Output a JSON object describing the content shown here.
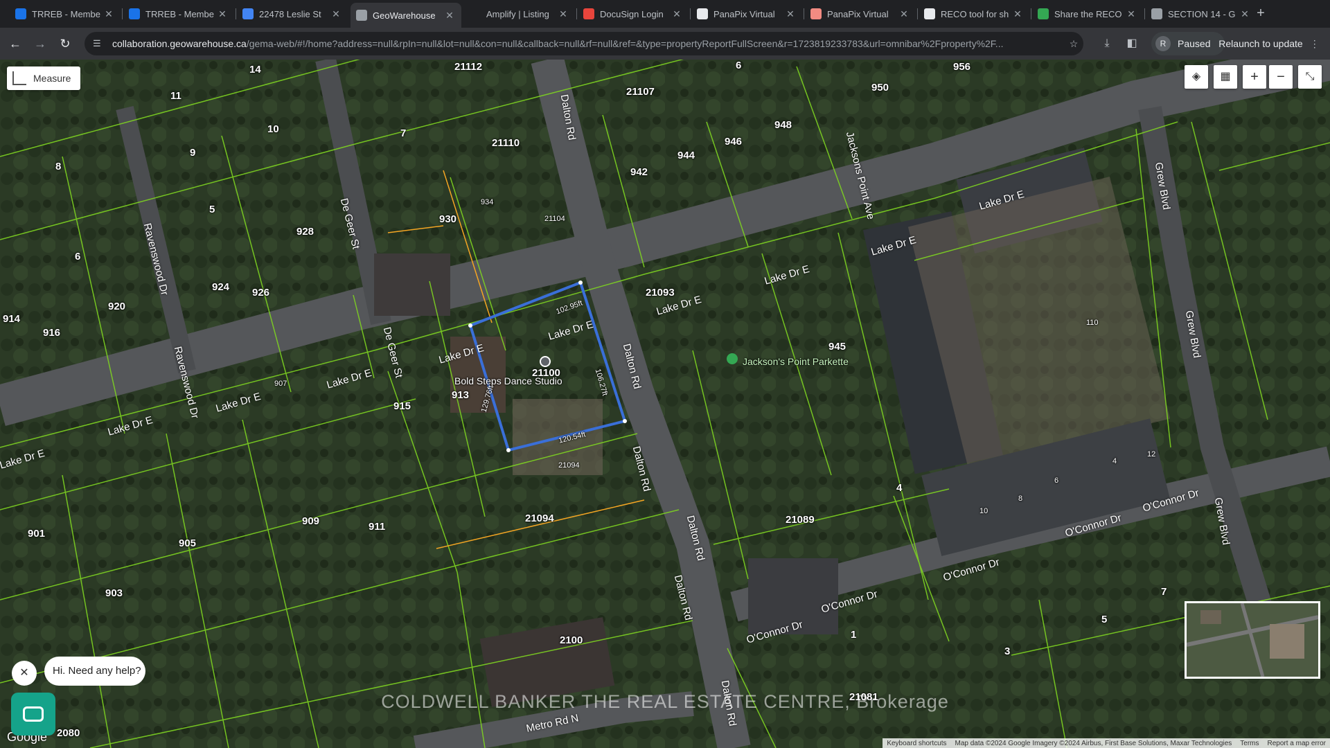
{
  "tabs": [
    {
      "title": "TRREB - Membe",
      "favicon_color": "#1a73e8",
      "active": false
    },
    {
      "title": "TRREB - Membe",
      "favicon_color": "#1a73e8",
      "active": false
    },
    {
      "title": "22478 Leslie St",
      "favicon_color": "#4285f4",
      "active": false
    },
    {
      "title": "GeoWarehouse",
      "favicon_color": "#9aa0a6",
      "active": true
    },
    {
      "title": "Amplify | Listing",
      "favicon_color": "#202124",
      "active": false
    },
    {
      "title": "DocuSign Login",
      "favicon_color": "#e8453c",
      "active": false
    },
    {
      "title": "PanaPix Virtual",
      "favicon_color": "#e8eaed",
      "active": false
    },
    {
      "title": "PanaPix Virtual",
      "favicon_color": "#f28b82",
      "active": false
    },
    {
      "title": "RECO tool for sh",
      "favicon_color": "#e8eaed",
      "active": false
    },
    {
      "title": "Share the RECO",
      "favicon_color": "#34a853",
      "active": false
    },
    {
      "title": "SECTION 14 - G",
      "favicon_color": "#9aa0a6",
      "active": false
    }
  ],
  "url": {
    "host": "collaboration.geowarehouse.ca",
    "path": "/gema-web/#!/home?address=null&rpIn=null&lot=null&con=null&callback=null&rf=null&ref=&type=propertyReportFullScreen&r=1723819233783&url=omnibar%2Fproperty%2F..."
  },
  "profile": {
    "initial": "R",
    "status": "Paused"
  },
  "relaunch_label": "Relaunch to update",
  "map": {
    "measure_label": "Measure",
    "highlight_color": "#3a6fd8",
    "parcel_line_color": "#7ed321",
    "parcels": [
      {
        "label": "21112"
      },
      {
        "label": "14"
      },
      {
        "label": "11"
      },
      {
        "label": "10"
      },
      {
        "label": "9"
      },
      {
        "label": "8"
      },
      {
        "label": "7"
      },
      {
        "label": "5"
      },
      {
        "label": "6"
      },
      {
        "label": "928"
      },
      {
        "label": "924"
      },
      {
        "label": "926"
      },
      {
        "label": "920"
      },
      {
        "label": "916"
      },
      {
        "label": "914"
      },
      {
        "label": "930"
      },
      {
        "label": "934"
      },
      {
        "label": "21104"
      },
      {
        "label": "21110"
      },
      {
        "label": "21107"
      },
      {
        "label": "944"
      },
      {
        "label": "942"
      },
      {
        "label": "946"
      },
      {
        "label": "948"
      },
      {
        "label": "950"
      },
      {
        "label": "956"
      },
      {
        "label": "6"
      },
      {
        "label": "21093"
      },
      {
        "label": "945"
      },
      {
        "label": "21100"
      },
      {
        "label": "915"
      },
      {
        "label": "913"
      },
      {
        "label": "907"
      },
      {
        "label": "909"
      },
      {
        "label": "905"
      },
      {
        "label": "903"
      },
      {
        "label": "901"
      },
      {
        "label": "911"
      },
      {
        "label": "21094"
      },
      {
        "label": "21094"
      },
      {
        "label": "21089"
      },
      {
        "label": "2100"
      },
      {
        "label": "1"
      },
      {
        "label": "3"
      },
      {
        "label": "5"
      },
      {
        "label": "7"
      },
      {
        "label": "4"
      },
      {
        "label": "21081"
      },
      {
        "label": "2080"
      },
      {
        "label": "10"
      },
      {
        "label": "8"
      },
      {
        "label": "6"
      },
      {
        "label": "12"
      },
      {
        "label": "4"
      },
      {
        "label": "110"
      }
    ],
    "roads": [
      {
        "name": "Lake Dr E"
      },
      {
        "name": "Lake Dr E"
      },
      {
        "name": "Lake Dr E"
      },
      {
        "name": "Lake Dr E"
      },
      {
        "name": "Lake Dr E"
      },
      {
        "name": "Lake Dr E"
      },
      {
        "name": "Lake Dr E"
      },
      {
        "name": "Lake Dr E"
      },
      {
        "name": "Lake Dr E"
      },
      {
        "name": "Lake Dr E"
      },
      {
        "name": "Dalton Rd"
      },
      {
        "name": "Dalton Rd"
      },
      {
        "name": "Dalton Rd"
      },
      {
        "name": "Dalton Rd"
      },
      {
        "name": "Dalton Rd"
      },
      {
        "name": "Dalton Rd"
      },
      {
        "name": "De Geer St"
      },
      {
        "name": "De Geer St"
      },
      {
        "name": "Ravenswood Dr"
      },
      {
        "name": "Ravenswood Dr"
      },
      {
        "name": "Jacksons Point Ave"
      },
      {
        "name": "Grew Blvd"
      },
      {
        "name": "Grew Blvd"
      },
      {
        "name": "Grew Blvd"
      },
      {
        "name": "O'Connor Dr"
      },
      {
        "name": "O'Connor Dr"
      },
      {
        "name": "O'Connor Dr"
      },
      {
        "name": "O'Connor Dr"
      },
      {
        "name": "O'Connor Dr"
      },
      {
        "name": "Metro Rd N"
      }
    ],
    "poi": [
      {
        "name": "Bold Steps Dance Studio"
      },
      {
        "name": "Jackson's Point Parkette"
      }
    ],
    "dimensions": [
      "102.95ft",
      "106.27ft",
      "120.54ft",
      "129.76ft"
    ],
    "watermark": "COLDWELL BANKER THE REAL ESTATE CENTRE, Brokerage",
    "google_logo": "Google",
    "attribution": [
      "Keyboard shortcuts",
      "Map data ©2024 Google Imagery ©2024 Airbus, First Base Solutions, Maxar Technologies",
      "Terms",
      "Report a map error"
    ]
  },
  "chat": {
    "prompt": "Hi. Need any help?"
  }
}
